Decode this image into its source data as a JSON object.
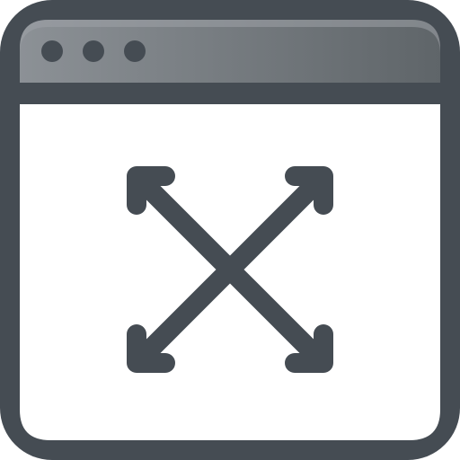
{
  "icon": {
    "name": "expand-window-icon",
    "window_controls": [
      "dot-icon",
      "dot-icon",
      "dot-icon"
    ],
    "content_icon": "expand-arrows-icon"
  },
  "colors": {
    "frame": "#454c53",
    "titlebar_light": "#8c9196",
    "titlebar_dark": "#5f6569",
    "titlebar_highlight": "#9ea3a7",
    "content_background": "#ffffff",
    "arrows": "#454c53"
  }
}
